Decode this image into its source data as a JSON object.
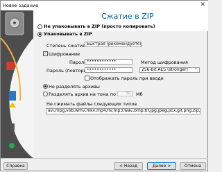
{
  "window": {
    "title": "Новое задание",
    "close_glyph": "✕"
  },
  "heading": "Сжатие в ZIP",
  "compression_options": [
    {
      "label": "Не упаковывать в ZIP (просто копировать)",
      "selected": false
    },
    {
      "label": "Упаковывать в ZIP",
      "selected": true
    }
  ],
  "compression_level": {
    "label": "Степень сжатия",
    "value": "Быстрая (рекомендуется)"
  },
  "encryption": {
    "checkbox_label": "Шифрование",
    "checked": true,
    "password_label": "Пароль",
    "password_value": "••••••••••••",
    "confirm_label": "Пароль (повторно)",
    "confirm_value": "••••••••••••",
    "method_label": "Метод шифрования",
    "method_value": "256-bit  AES (stronger)",
    "show_password_label": "Отображать пароль при вводе"
  },
  "split": {
    "no_split_label": "Не разделять архивы",
    "split_label": "Разделять архив на тома по",
    "volume_size": "30",
    "unit": "Мб"
  },
  "exclude": {
    "label": "Не сжимать файлы следующих типов",
    "value": "avi,mpg,vob,wmv,mkv,mp4,flv,mp3,wav,bmp,tif,jpg,jpeg,pcx,gif,png,zip,rar"
  },
  "buttons": {
    "help": "Справка",
    "back": "< Назад",
    "next": "Далее >",
    "cancel": "Отмена"
  }
}
